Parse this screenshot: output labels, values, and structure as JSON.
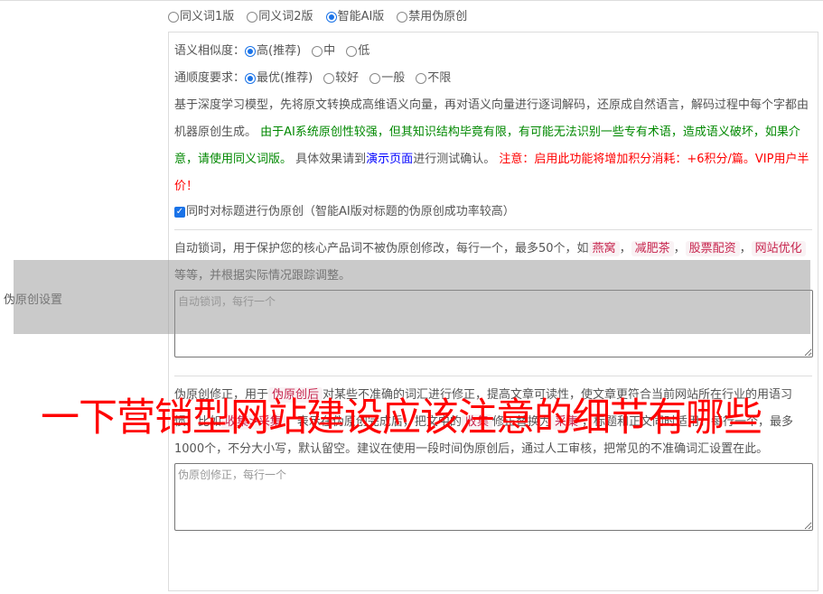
{
  "side_label": "伪原创设置",
  "modes": [
    {
      "label": "同义词1版",
      "checked": false
    },
    {
      "label": "同义词2版",
      "checked": false
    },
    {
      "label": "智能AI版",
      "checked": true
    },
    {
      "label": "禁用伪原创",
      "checked": false
    }
  ],
  "similarity": {
    "label": "语义相似度：",
    "options": [
      {
        "label": "高(推荐)",
        "checked": true
      },
      {
        "label": "中",
        "checked": false
      },
      {
        "label": "低",
        "checked": false
      }
    ]
  },
  "fluency": {
    "label": "通顺度要求：",
    "options": [
      {
        "label": "最优(推荐)",
        "checked": true
      },
      {
        "label": "较好",
        "checked": false
      },
      {
        "label": "一般",
        "checked": false
      },
      {
        "label": "不限",
        "checked": false
      }
    ]
  },
  "desc": {
    "p1": "基于深度学习模型，先将原文转换成高维语义向量，再对语义向量进行逐词解码，还原成自然语言，解码过程中每个字都由机器原创生成。",
    "p2_green": "由于AI系统原创性较强，但其知识结构毕竟有限，有可能无法识别一些专有术语，造成语义破坏，如果介意，请使用同义词版。",
    "p3": "具体效果请到",
    "link": "演示页面",
    "p4": "进行测试确认。",
    "p5_red": "注意：启用此功能将增加积分消耗：+6积分/篇。VIP用户半价！"
  },
  "title_checkbox": {
    "label": "同时对标题进行伪原创（智能AI版对标题的伪原创成功率较高）",
    "checked": true
  },
  "lock": {
    "text1": "自动锁词，用于保护您的核心产品词不被伪原创修改，每行一个，最多50个，如",
    "tags": [
      "燕窝",
      "减肥茶",
      "股票配资",
      "网站优化"
    ],
    "sep": "，",
    "text2": "等等，并根据实际情况跟踪调整。",
    "placeholder": "自动锁词，每行一个"
  },
  "fix": {
    "t1": "伪原创修正，用于",
    "tag1": "伪原创后",
    "t2": "对某些不准确的词汇进行修正，提高文章可读性，使文章更符合当前网站所在行业的用语习惯。比如",
    "tag2": "收集>采集",
    "t3": "，表示在伪原创完成后，把文中的",
    "tag3": "收集",
    "t4": "修正替换为",
    "tag4": "采集",
    "t5": "，标题和正文同时适用，每行一个，最多1000个，不分大小写，默认留空。建议在使用一段时间伪原创后，通过人工审核，把常见的不准确词汇设置在此。",
    "placeholder": "伪原创修正，每行一个"
  },
  "headline": "一下营销型网站建设应该注意的细节有哪些"
}
